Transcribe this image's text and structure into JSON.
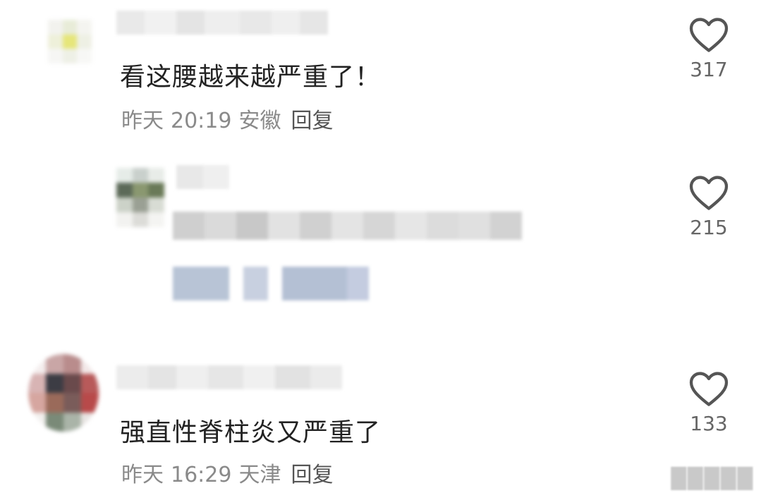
{
  "comments": [
    {
      "text": "看这腰越来越严重了！",
      "date": "昨天",
      "time": "20:19",
      "location": "安徽",
      "reply_label": "回复",
      "likes": "317"
    },
    {
      "text": "",
      "likes": "215"
    },
    {
      "text": "强直性脊柱炎又严重了",
      "date": "昨天",
      "time": "16:29",
      "location": "天津",
      "reply_label": "回复",
      "likes": "133"
    }
  ],
  "icons": {
    "like": "heart-outline-icon"
  },
  "colors": {
    "meta": "#8a8a8a",
    "heart": "#555555",
    "count": "#666666"
  }
}
